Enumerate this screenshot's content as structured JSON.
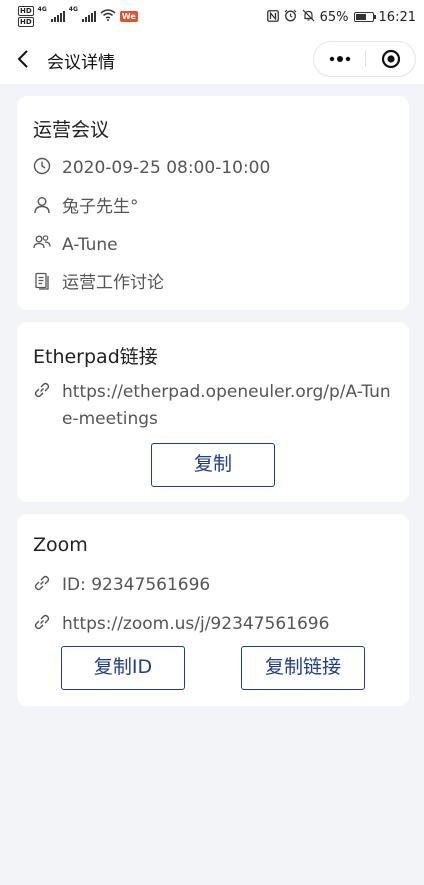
{
  "status_bar": {
    "signal_labels": [
      "4G",
      "4G"
    ],
    "app_badge": "We",
    "battery": "65%",
    "time": "16:21"
  },
  "nav": {
    "title": "会议详情"
  },
  "meeting": {
    "title": "运营会议",
    "time": "2020-09-25 08:00-10:00",
    "host": "兔子先生°",
    "group": "A-Tune",
    "topic": "运营工作讨论"
  },
  "etherpad": {
    "title": "Etherpad链接",
    "url": "https://etherpad.openeuler.org/p/A-Tune-meetings",
    "copy_label": "复制"
  },
  "zoom": {
    "title": "Zoom",
    "id_text": "ID: 92347561696",
    "url": "https://zoom.us/j/92347561696",
    "copy_id_label": "复制ID",
    "copy_link_label": "复制链接"
  },
  "colors": {
    "accent": "#1f3d8c",
    "background": "#f2f4f8",
    "card": "#ffffff"
  }
}
